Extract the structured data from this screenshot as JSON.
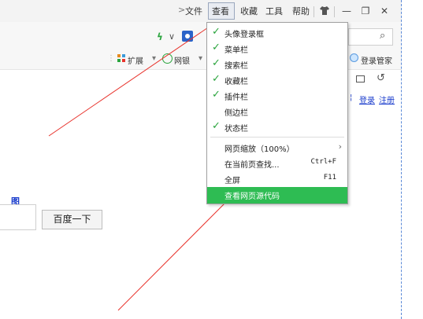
{
  "menubar": {
    "more_arrow": ">",
    "items": [
      "文件",
      "查看",
      "收藏",
      "工具",
      "帮助"
    ],
    "selected": "查看"
  },
  "window_controls": {
    "skin": "shirt-icon",
    "minimize": "—",
    "restore": "❐",
    "close": "✕"
  },
  "toolbar": {
    "lightning": "ϟ",
    "dropdown": "∨",
    "search_icon": "⌕"
  },
  "bookmarks": {
    "extensions": "扩展",
    "netbank": "网银",
    "login_manager": "登录管家"
  },
  "header_links": {
    "partial": "¦",
    "login": "登录",
    "register": "注册"
  },
  "view_menu": {
    "items": [
      {
        "label": "头像登录框",
        "checked": true
      },
      {
        "label": "菜单栏",
        "checked": true
      },
      {
        "label": "搜索栏",
        "checked": true
      },
      {
        "label": "收藏栏",
        "checked": true
      },
      {
        "label": "插件栏",
        "checked": true
      },
      {
        "label": "侧边栏",
        "checked": false
      },
      {
        "label": "状态栏",
        "checked": true
      },
      {
        "label": "网页缩放（100%）",
        "submenu": true
      },
      {
        "label": "在当前页查找...",
        "shortcut": "Ctrl+F"
      },
      {
        "label": "全屏",
        "shortcut": "F11"
      },
      {
        "label": "查看网页源代码",
        "highlighted": true
      }
    ]
  },
  "page": {
    "image_link": "图",
    "search_button": "百度一下"
  },
  "colors": {
    "highlight": "#2ebc53",
    "check": "#2aa43d",
    "arrow": "#e8322b",
    "link": "#1a3ccc"
  }
}
